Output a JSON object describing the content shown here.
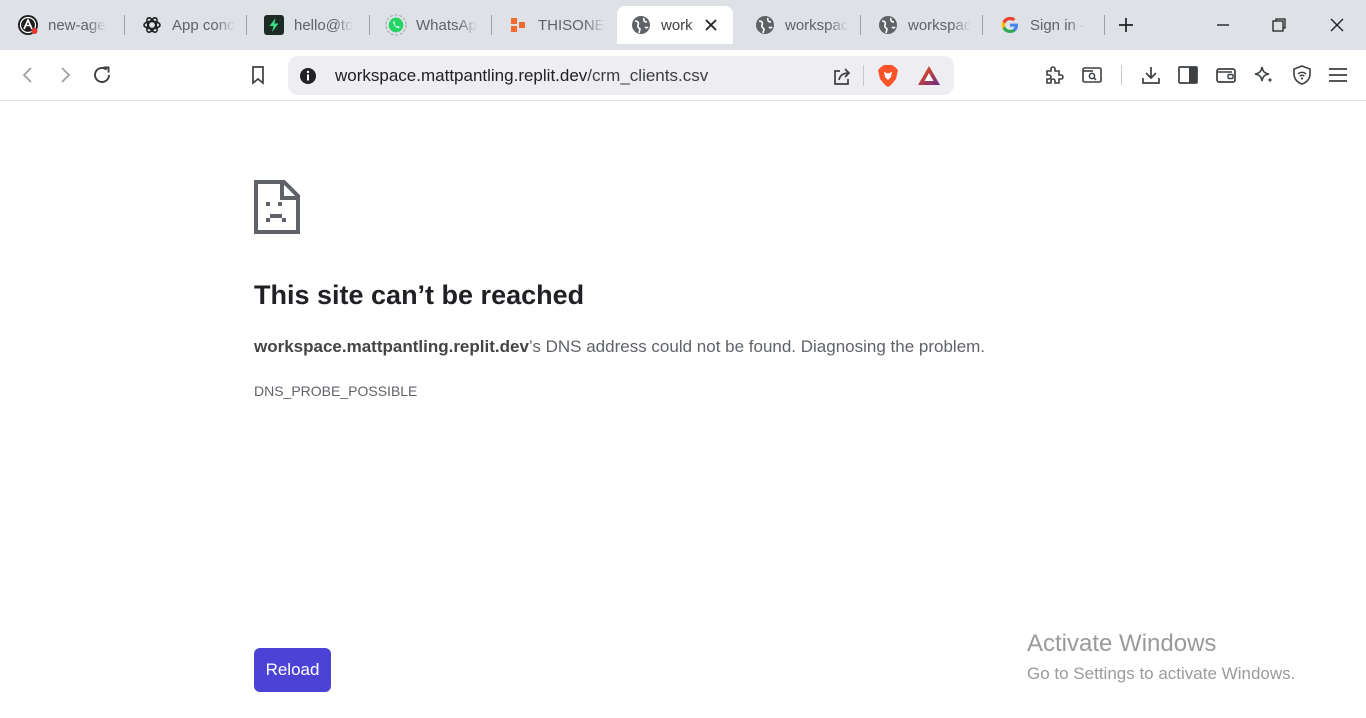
{
  "tabs": [
    {
      "label": "new-age",
      "icon": "dark-a-logo-icon"
    },
    {
      "label": "App conc",
      "icon": "openai-icon"
    },
    {
      "label": "hello@to",
      "icon": "bolt-icon"
    },
    {
      "label": "WhatsAp",
      "icon": "whatsapp-icon"
    },
    {
      "label": "THISONE",
      "icon": "orange-blocks-icon"
    },
    {
      "label": "work",
      "icon": "globe-icon",
      "active": true
    },
    {
      "label": "workspac",
      "icon": "globe-icon"
    },
    {
      "label": "workspac",
      "icon": "globe-icon"
    },
    {
      "label": "Sign in -",
      "icon": "google-icon"
    }
  ],
  "omnibox": {
    "host": "workspace.mattpantling.replit.dev",
    "path": "/crm_clients.csv"
  },
  "error": {
    "title": "This site can’t be reached",
    "host": "workspace.mattpantling.replit.dev",
    "desc_suffix": "’s DNS address could not be found. Diagnosing the problem.",
    "code": "DNS_PROBE_POSSIBLE",
    "reload_label": "Reload"
  },
  "watermark": {
    "title": "Activate Windows",
    "subtitle": "Go to Settings to activate Windows."
  },
  "colors": {
    "accent": "#4c42d6",
    "tabstrip": "#dee1e6",
    "omnibox": "#eeedf2",
    "brave_orange": "#fb542b",
    "whatsapp_green": "#25d366"
  }
}
